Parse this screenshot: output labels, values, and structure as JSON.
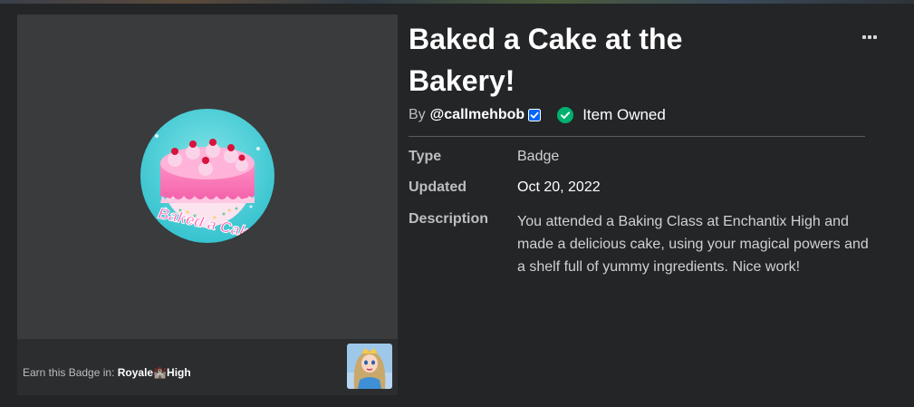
{
  "badge": {
    "title": "Baked a Cake at the Bakery!",
    "image_text": "Baked a Cake",
    "by_label": "By",
    "creator": "@callmehbob",
    "owned_label": "Item Owned"
  },
  "details": {
    "type_label": "Type",
    "type_value": "Badge",
    "updated_label": "Updated",
    "updated_value": "Oct 20, 2022",
    "description_label": "Description",
    "description_value": "You attended a Baking Class at Enchantix High and made a delicious cake, using your magical powers and a shelf full of yummy ingredients. Nice work!"
  },
  "earn": {
    "label": "Earn this Badge in:",
    "game_name": "Royale🏰High"
  },
  "colors": {
    "background": "#232527",
    "panel": "#393b3d",
    "owned_green": "#00b06f",
    "verified_blue": "#0066ff"
  },
  "icons": {
    "menu": "more-dots-icon",
    "verified": "verified-badge-icon",
    "owned": "checkmark-circle-icon"
  }
}
